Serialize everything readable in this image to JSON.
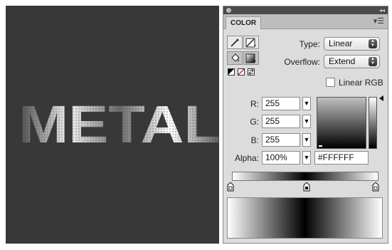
{
  "canvas": {
    "artwork_text": "METAL"
  },
  "panel": {
    "tab_label": "COLOR",
    "menu_icon": "panel-menu-icon",
    "collapse_icon": "collapse-arrows-icon"
  },
  "type_control": {
    "label": "Type:",
    "value": "Linear"
  },
  "overflow_control": {
    "label": "Overflow:",
    "value": "Extend"
  },
  "linear_rgb": {
    "label": "Linear RGB",
    "checked": false
  },
  "rgb": {
    "r_label": "R:",
    "r_value": "255",
    "g_label": "G:",
    "g_value": "255",
    "b_label": "B:",
    "b_value": "255"
  },
  "alpha": {
    "label": "Alpha:",
    "value": "100%",
    "hex": "#FFFFFF"
  },
  "colors": {
    "stage_bg": "#383838",
    "panel_bg": "#dcdcdc",
    "gradient_stops": [
      "#ffffff",
      "#000000",
      "#ffffff"
    ]
  }
}
